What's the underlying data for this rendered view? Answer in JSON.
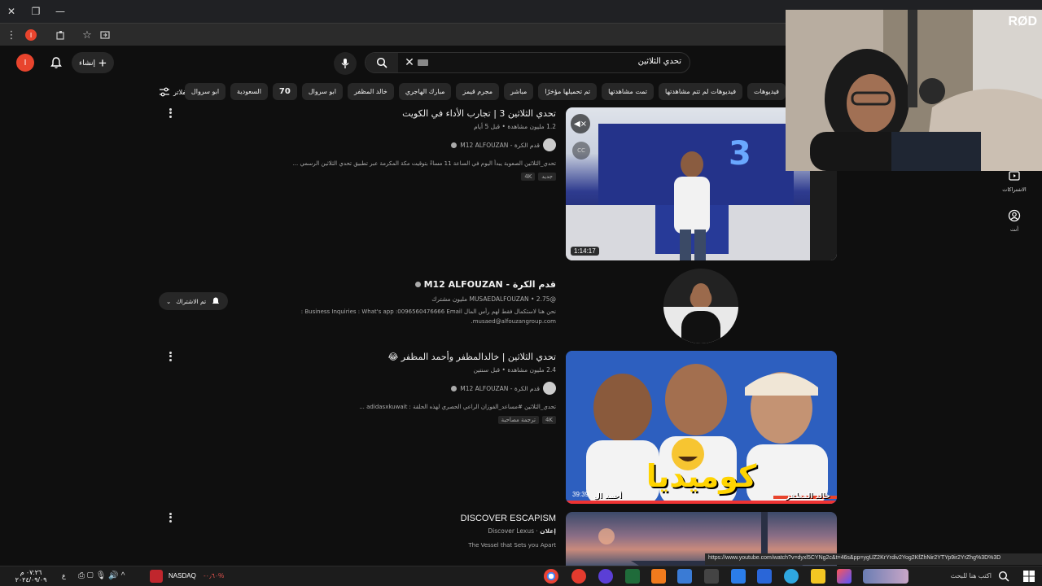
{
  "browser": {
    "url_status": "https://www.youtube.com/watch?v=dyxl5CYNg2c&t=46s&pp=ygUZ2KrYrdiv2Yog2KfZhNir2YTYp9ir2YrZhg%3D%3D",
    "profile_letter": "I"
  },
  "header": {
    "avatar_letter": "I",
    "create_label": "إنشاء",
    "search_query": "تحدي الثلاثين"
  },
  "chips": {
    "filters_label": "الفلاتر",
    "items": [
      "فيديوهات",
      "فيديوهات لم تتم مشاهدتها",
      "تمت مشاهدتها",
      "تم تحميلها مؤخرًا",
      "مباشر",
      "مجرم قيمز",
      "مبارك الهاجري",
      "خالد المظفر",
      "ابو سروال",
      "70",
      "السعودية",
      "ابو سروال"
    ]
  },
  "results": [
    {
      "title": "تحدي الثلاثين 3 | تجارب الأداء في الكويت",
      "meta": "1.2 مليون مشاهدة • قبل 5 أيام",
      "channel": "قدم الكرة - M12 ALFOUZAN",
      "description": "تحدي_الثلاثين الصعوبة يبدأ اليوم في الساعة 11 مساءً بتوقيت مكة المكرمة عبر تطبيق تحدي الثلاثين الرسمي ...",
      "badges": [
        "جديد",
        "4K"
      ],
      "duration": "1:14:17"
    },
    {
      "title": "تحدي الثلاثين | خالدالمظفر وأحمد المظفر 😂",
      "meta": "2.4 مليون مشاهدة • قبل سنتين",
      "channel": "قدم الكرة - M12 ALFOUZAN",
      "description": "تحدي_الثلاثين #مساعد_الفوزان الراعي الحصري لهذه الحلقة : adidasxkuwait ...",
      "badges": [
        "ترجمة مصاحبة",
        "4K"
      ],
      "duration": "39:39",
      "overlay_text": "كوميديا",
      "name_left": "أحمد ال",
      "name_right": "خالد المظفر"
    },
    {
      "title": "DISCOVER ESCAPISM",
      "channel": "Discover Lexus",
      "sponsored": "إعلان",
      "description": "The Vessel that Sets you Apart"
    }
  ],
  "channel_card": {
    "name": "قدم الكرة - M12 ALFOUZAN",
    "handle": "@MUSAEDALFOUZAN • 2.75 مليون مشترك",
    "about": "نحن هنا لاستكمال فقط لهم رأس المال Business Inquiries : What's app :0096560476666 Email :",
    "email": "musaed@alfouzangroup.com.",
    "subscribe_label": "تم الاشتراك"
  },
  "right_nav": {
    "subscriptions_label": "الاشتراكات",
    "you_label": "أنت"
  },
  "webcam": {
    "label": "RØD"
  },
  "taskbar": {
    "ticker_name": "NASDAQ",
    "ticker_change": "-٠٫٦٠%",
    "search_placeholder": "اكتب هنا للبحث",
    "time": "٠٧:٢٦ م",
    "date": "٢٠٢٤/٠٩/٠٩",
    "lang": "ع"
  }
}
